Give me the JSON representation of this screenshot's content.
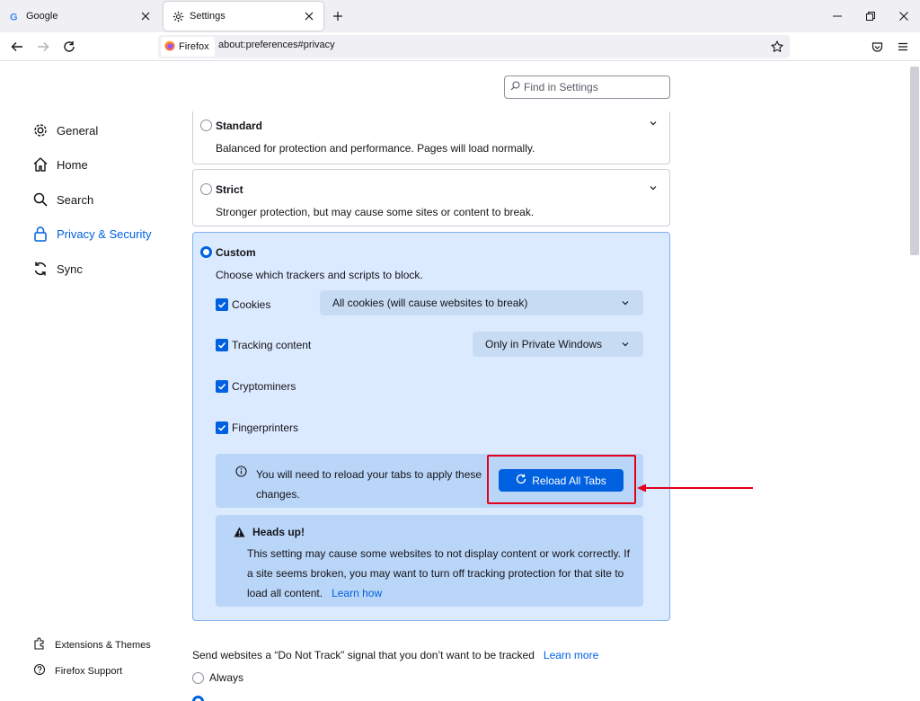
{
  "tabs": [
    {
      "title": "Google",
      "icon": "google-icon"
    },
    {
      "title": "Settings",
      "icon": "gear-icon"
    }
  ],
  "urlbar": {
    "identity": "Firefox",
    "url": "about:preferences#privacy"
  },
  "search": {
    "placeholder": "Find in Settings"
  },
  "sidebar": {
    "items": [
      {
        "label": "General",
        "icon": "gear-icon"
      },
      {
        "label": "Home",
        "icon": "home-icon"
      },
      {
        "label": "Search",
        "icon": "search-icon"
      },
      {
        "label": "Privacy & Security",
        "icon": "lock-icon",
        "selected": true
      },
      {
        "label": "Sync",
        "icon": "sync-icon"
      }
    ],
    "footer": [
      {
        "label": "Extensions & Themes",
        "icon": "puzzle-icon"
      },
      {
        "label": "Firefox Support",
        "icon": "help-icon"
      }
    ]
  },
  "protection": {
    "standard": {
      "title": "Standard",
      "desc": "Balanced for protection and performance. Pages will load normally."
    },
    "strict": {
      "title": "Strict",
      "desc": "Stronger protection, but may cause some sites or content to break."
    },
    "custom": {
      "title": "Custom",
      "desc": "Choose which trackers and scripts to block.",
      "options": [
        {
          "label": "Cookies",
          "checked": true,
          "dropdown": "All cookies (will cause websites to break)"
        },
        {
          "label": "Tracking content",
          "checked": true,
          "dropdown": "Only in Private Windows"
        },
        {
          "label": "Cryptominers",
          "checked": true
        },
        {
          "label": "Fingerprinters",
          "checked": true
        }
      ],
      "reload_message": "You will need to reload your tabs to apply these changes.",
      "reload_button": "Reload All Tabs",
      "headsup_title": "Heads up!",
      "headsup_body": "This setting may cause some websites to not display content or work correctly. If a site seems broken, you may want to turn off tracking protection for that site to load all content.",
      "headsup_link": "Learn how"
    }
  },
  "dnt": {
    "text": "Send websites a “Do Not Track” signal that you don’t want to be tracked",
    "link": "Learn more",
    "option_always": "Always"
  },
  "colors": {
    "accent": "#0061e0",
    "highlight": "#e3001b"
  }
}
